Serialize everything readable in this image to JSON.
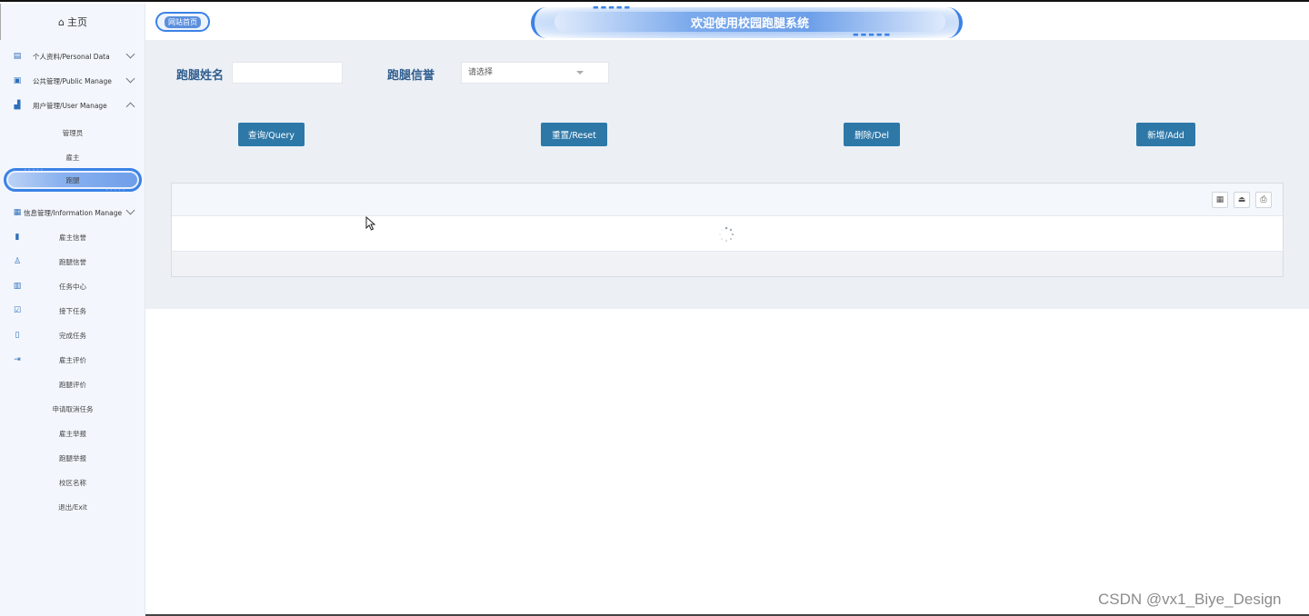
{
  "sidebar": {
    "home_label": "主页",
    "menus": [
      {
        "label": "个人资料/Personal Data",
        "icon": "profile-doc-icon",
        "chevron": "down"
      },
      {
        "label": "公共管理/Public Manage",
        "icon": "clipboard-icon",
        "chevron": "down"
      },
      {
        "label": "用户管理/User Manage",
        "icon": "users-chart-icon",
        "chevron": "up"
      }
    ],
    "user_sub": [
      "管理员",
      "雇主",
      "跑腿"
    ],
    "active_item": "跑腿",
    "info_menu": {
      "label": "信息管理/Information Manage",
      "icon": "building-icon",
      "chevron": "down"
    },
    "info_sub": [
      {
        "label": "雇主信誉",
        "icon": "bookmark-icon"
      },
      {
        "label": "跑腿信誉",
        "icon": "person-badge-icon"
      },
      {
        "label": "任务中心",
        "icon": "calendar-icon"
      },
      {
        "label": "接下任务",
        "icon": "calendar-check-icon"
      },
      {
        "label": "完成任务",
        "icon": "book-icon"
      },
      {
        "label": "雇主评价",
        "icon": "logout-arrow-icon"
      },
      {
        "label": "跑腿评价",
        "icon": ""
      },
      {
        "label": "申请取消任务",
        "icon": ""
      },
      {
        "label": "雇主举报",
        "icon": ""
      },
      {
        "label": "跑腿举报",
        "icon": ""
      },
      {
        "label": "校区名称",
        "icon": ""
      },
      {
        "label": "退出/Exit",
        "icon": ""
      }
    ]
  },
  "header": {
    "home_link": "网站首页",
    "welcome": "欢迎使用校园跑腿系统"
  },
  "search": {
    "name_label": "跑腿姓名",
    "name_value": "",
    "reputation_label": "跑腿信誉",
    "reputation_placeholder": "请选择"
  },
  "buttons": {
    "query": "查询/Query",
    "reset": "重置/Reset",
    "delete": "删除/Del",
    "add": "新增/Add"
  },
  "table": {
    "tools": [
      "grid-icon",
      "export-icon",
      "print-icon"
    ],
    "loading": true
  },
  "watermark": "CSDN @vx1_Biye_Design",
  "colors": {
    "accent": "#3b82e6",
    "button": "#2e78a8",
    "label": "#2f5d8e"
  }
}
